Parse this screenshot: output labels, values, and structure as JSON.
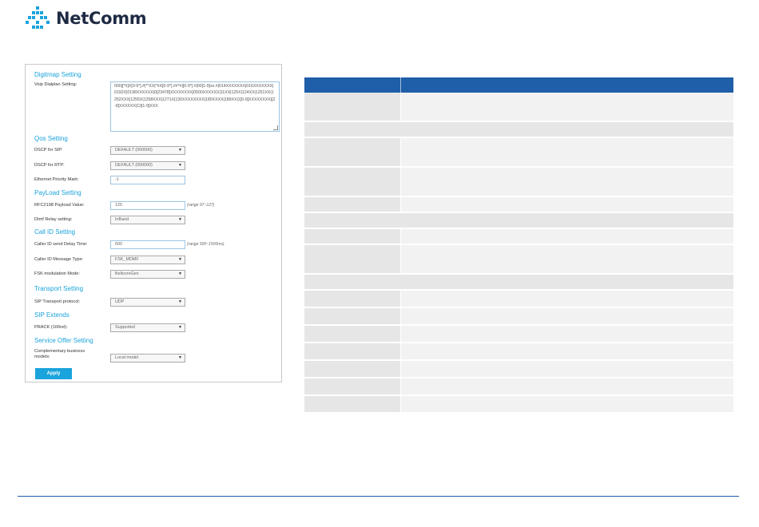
{
  "brand": {
    "name": "NetComm",
    "color": "#1f2a44",
    "accent": "#1aa3dc"
  },
  "sections": {
    "digitmap": "Digitmap Setting",
    "qos": "Qos Setting",
    "payload": "PayLoad Setting",
    "callid": "Call ID Setting",
    "transport": "Transport Setting",
    "sip_extends": "SIP Extends",
    "service_offer": "Service Offer Setting"
  },
  "fields": {
    "voip_dialplan": {
      "label": "Voip Dialplan Setting:",
      "value": "000|[*#]X[0-9*].#|**XX|*#X[0-9*].##*#|[0-9*].#|00[1-9]xx.#|014XXXXXXX|016XXXXXXX|0192X|0198XXXXXX|0[23478]XXXXXXXX|0500XXXXXX|11XX|125X|124XX|1251XX|1252XXX|1255X|1258XXX|1271X|130XXXXXXXX|180XXXX|189XX|1[0-9]XXXXXXXX|[2-9]XXXXXX|13[1-9]XXX"
    },
    "dscp_sip": {
      "label": "DSCP for SIP:",
      "value": "DEFAULT (000000)"
    },
    "dscp_rtp": {
      "label": "DSCP for RTP:",
      "value": "DEFAULT (000000)"
    },
    "eth_priority": {
      "label": "Ethernet Priority Mark:",
      "value": "-1"
    },
    "rfc2198": {
      "label": "RFC2198 Payload Value:",
      "value": "125",
      "hint": "(range 97~127)"
    },
    "dtmf_relay": {
      "label": "Dtmf Relay setting:",
      "value": "InBand"
    },
    "callerid_delay": {
      "label": "Caller ID send Delay Time:",
      "value": "600",
      "hint": "(range 500~1500ms)"
    },
    "callerid_type": {
      "label": "Caller ID Message Type:",
      "value": "FSK_MDMF"
    },
    "fsk_mode": {
      "label": "FSK modulation Mode:",
      "value": "BellcoreGen"
    },
    "sip_transport": {
      "label": "SIP Transport protocol:",
      "value": "UDP"
    },
    "prack": {
      "label": "PRACK (100rel):",
      "value": "Supported"
    },
    "business_model": {
      "label_line1": "Complementary business",
      "label_line2": "models:",
      "value": "Local model"
    }
  },
  "apply_label": "Apply",
  "colors": {
    "table_header": "#1f5ea8",
    "row_dark": "#e6e6e6",
    "row_light": "#f2f2f2"
  }
}
